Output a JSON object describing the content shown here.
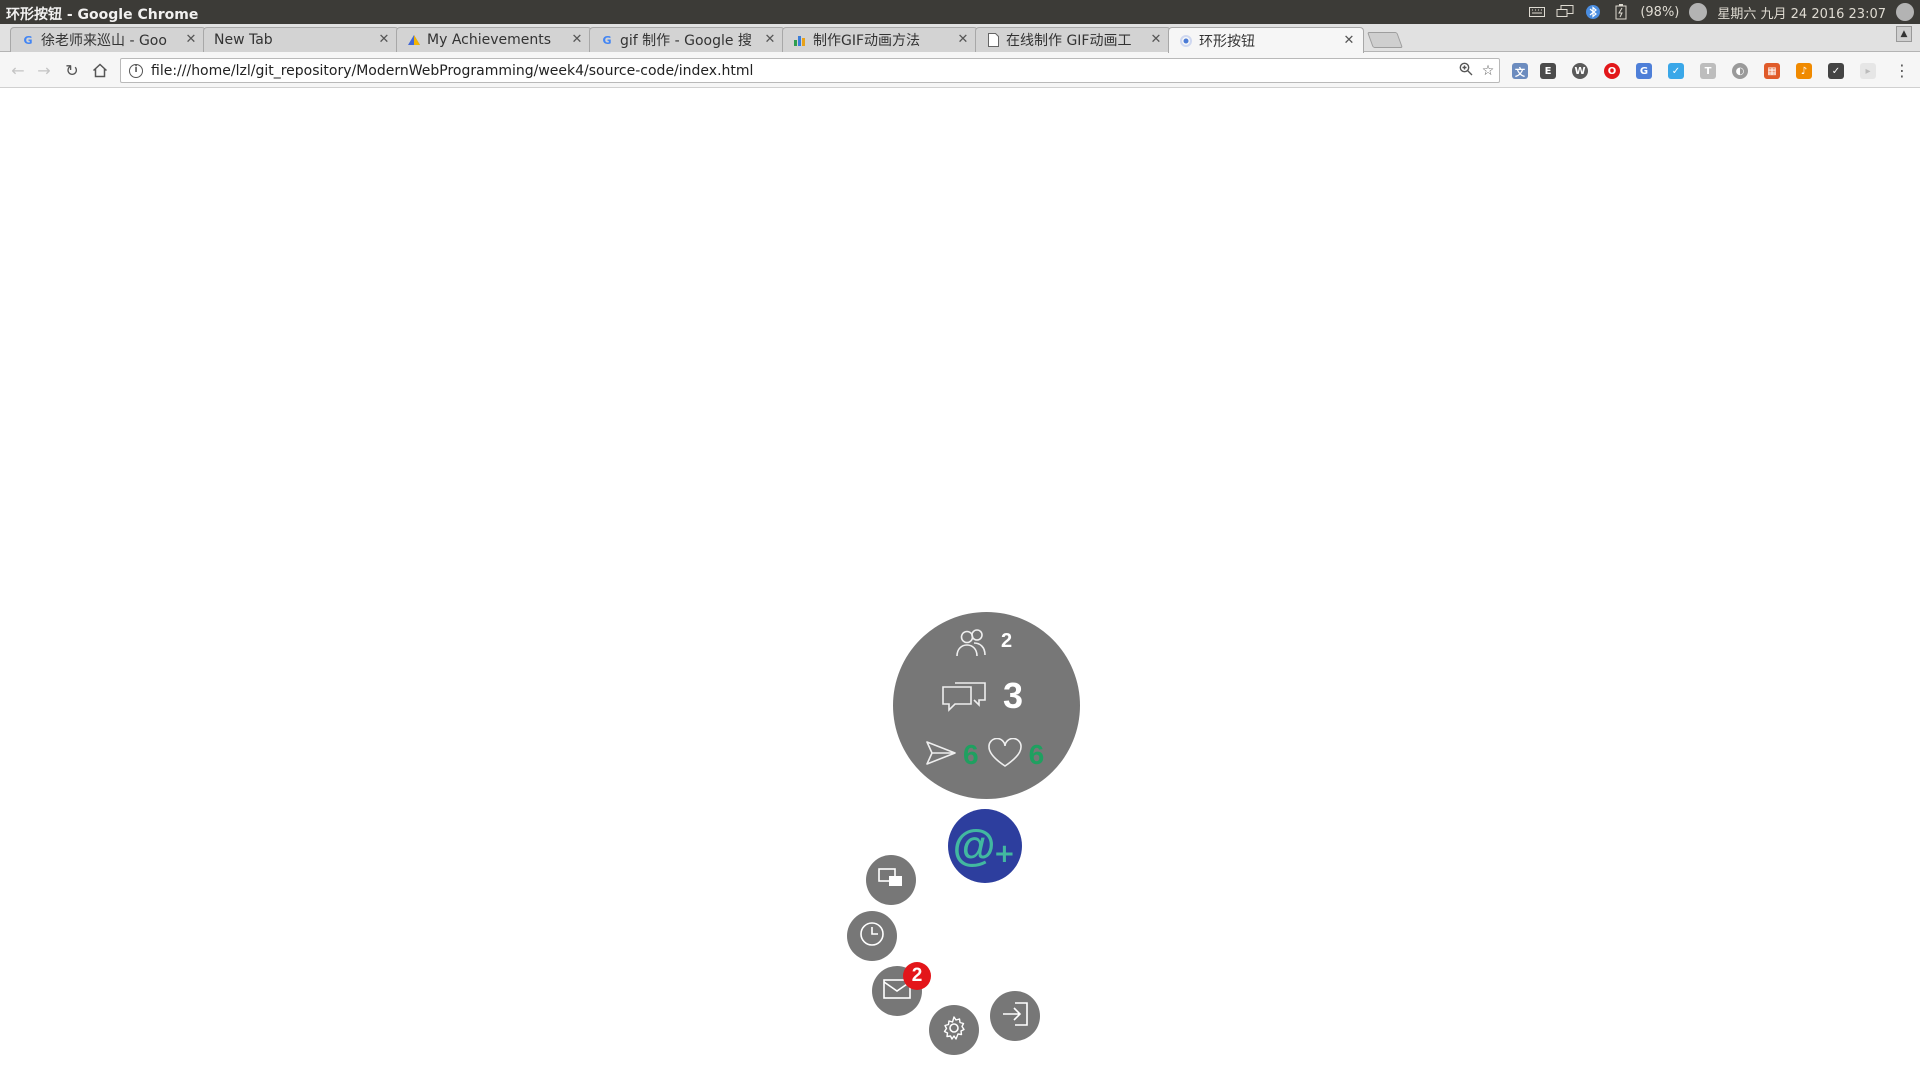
{
  "os": {
    "window_title": "环形按钮 - Google Chrome",
    "battery": "(98%)",
    "datetime": "星期六 九月 24 2016 23:07"
  },
  "tabs": [
    {
      "title": "徐老师来巡山 - Goo",
      "favicon": "google-icon",
      "active": false
    },
    {
      "title": "New Tab",
      "favicon": "",
      "active": false
    },
    {
      "title": "My Achievements",
      "favicon": "achievement-icon",
      "active": false
    },
    {
      "title": "gif 制作 - Google 搜",
      "favicon": "google-icon",
      "active": false
    },
    {
      "title": "制作GIF动画方法",
      "favicon": "chart-icon",
      "active": false
    },
    {
      "title": "在线制作 GIF动画工",
      "favicon": "page-icon",
      "active": false
    },
    {
      "title": "环形按钮",
      "favicon": "loading-icon",
      "active": true
    }
  ],
  "toolbar": {
    "url": "file:///home/lzl/git_repository/ModernWebProgramming/week4/source-code/index.html"
  },
  "ring_menu": {
    "users_count": "2",
    "messages_count": "3",
    "sent_count": "6",
    "likes_count": "6",
    "mail_badge": "2",
    "main_button_symbol": "@",
    "main_button_plus": "+",
    "colors": {
      "circle": "#777777",
      "main_button": "#2d3e9e",
      "accent_green": "#1fa060",
      "badge_red": "#e3161a"
    }
  }
}
